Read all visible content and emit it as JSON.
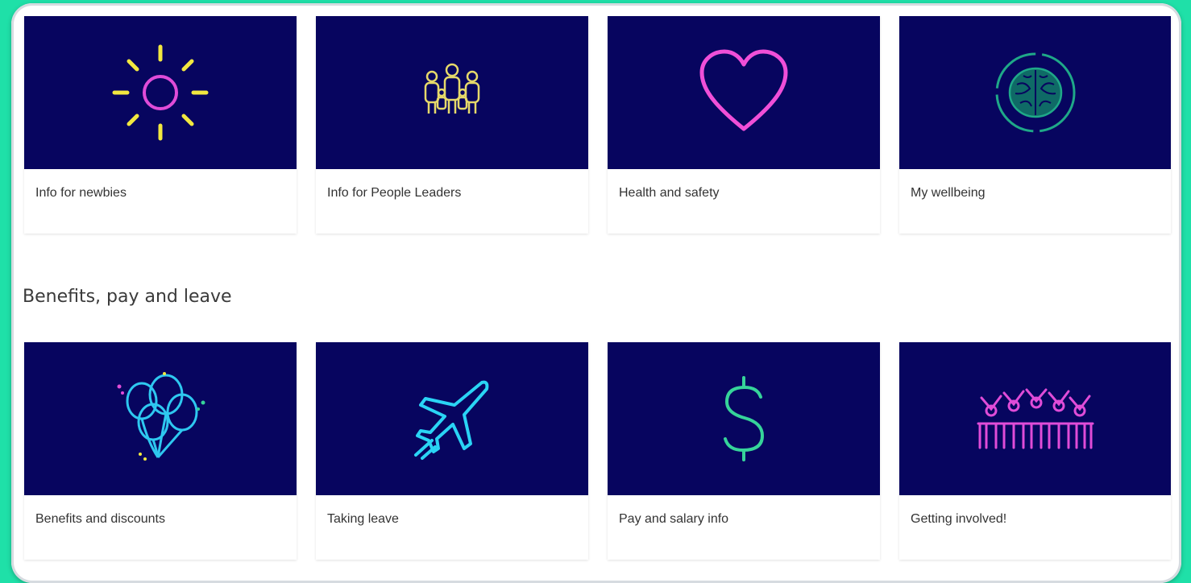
{
  "quicklinks": [
    {
      "label": "Info for newbies",
      "icon": "sun-icon",
      "color": "#f2e840"
    },
    {
      "label": "Info for People Leaders",
      "icon": "people-group-icon",
      "color": "#e6d96a"
    },
    {
      "label": "Health and safety",
      "icon": "heart-icon",
      "color": "#f04fd8"
    },
    {
      "label": "My wellbeing",
      "icon": "brain-icon",
      "color": "#1fa888"
    }
  ],
  "section": {
    "title": "Benefits, pay and leave"
  },
  "benefits": [
    {
      "label": "Benefits and discounts",
      "icon": "balloons-icon",
      "color": "#2ec8f0"
    },
    {
      "label": "Taking leave",
      "icon": "airplane-icon",
      "color": "#2ad4f5"
    },
    {
      "label": "Pay and salary info",
      "icon": "dollar-icon",
      "color": "#36d49a"
    },
    {
      "label": "Getting involved!",
      "icon": "celebration-icon",
      "color": "#e04cd8"
    }
  ]
}
